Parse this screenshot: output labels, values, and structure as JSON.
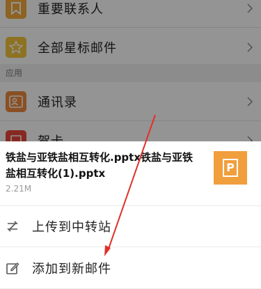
{
  "contacts_list": {
    "items": [
      {
        "label": "重要联系人",
        "icon": "bookmark-icon",
        "color": "#f3a93c"
      },
      {
        "label": "全部星标邮件",
        "icon": "star-icon",
        "color": "#f3c53c"
      }
    ],
    "section_header": "应用",
    "apps": [
      {
        "label": "通讯录",
        "icon": "contacts-icon",
        "color": "#ee8a3d"
      },
      {
        "label": "贺卡",
        "icon": "card-icon",
        "color": "#e8473d"
      }
    ]
  },
  "sheet": {
    "file_name": "铁盐与亚铁盐相互转化.pptx铁盐与亚铁盐相互转化(1).pptx",
    "file_size": "2.21M",
    "thumb_letter": "P",
    "thumb_color": "#f19e3c",
    "actions": [
      {
        "label": "上传到中转站",
        "icon": "transfer-icon"
      },
      {
        "label": "添加到新邮件",
        "icon": "edit-icon"
      }
    ]
  },
  "overlay": {
    "arrow_color": "#e0302a"
  }
}
